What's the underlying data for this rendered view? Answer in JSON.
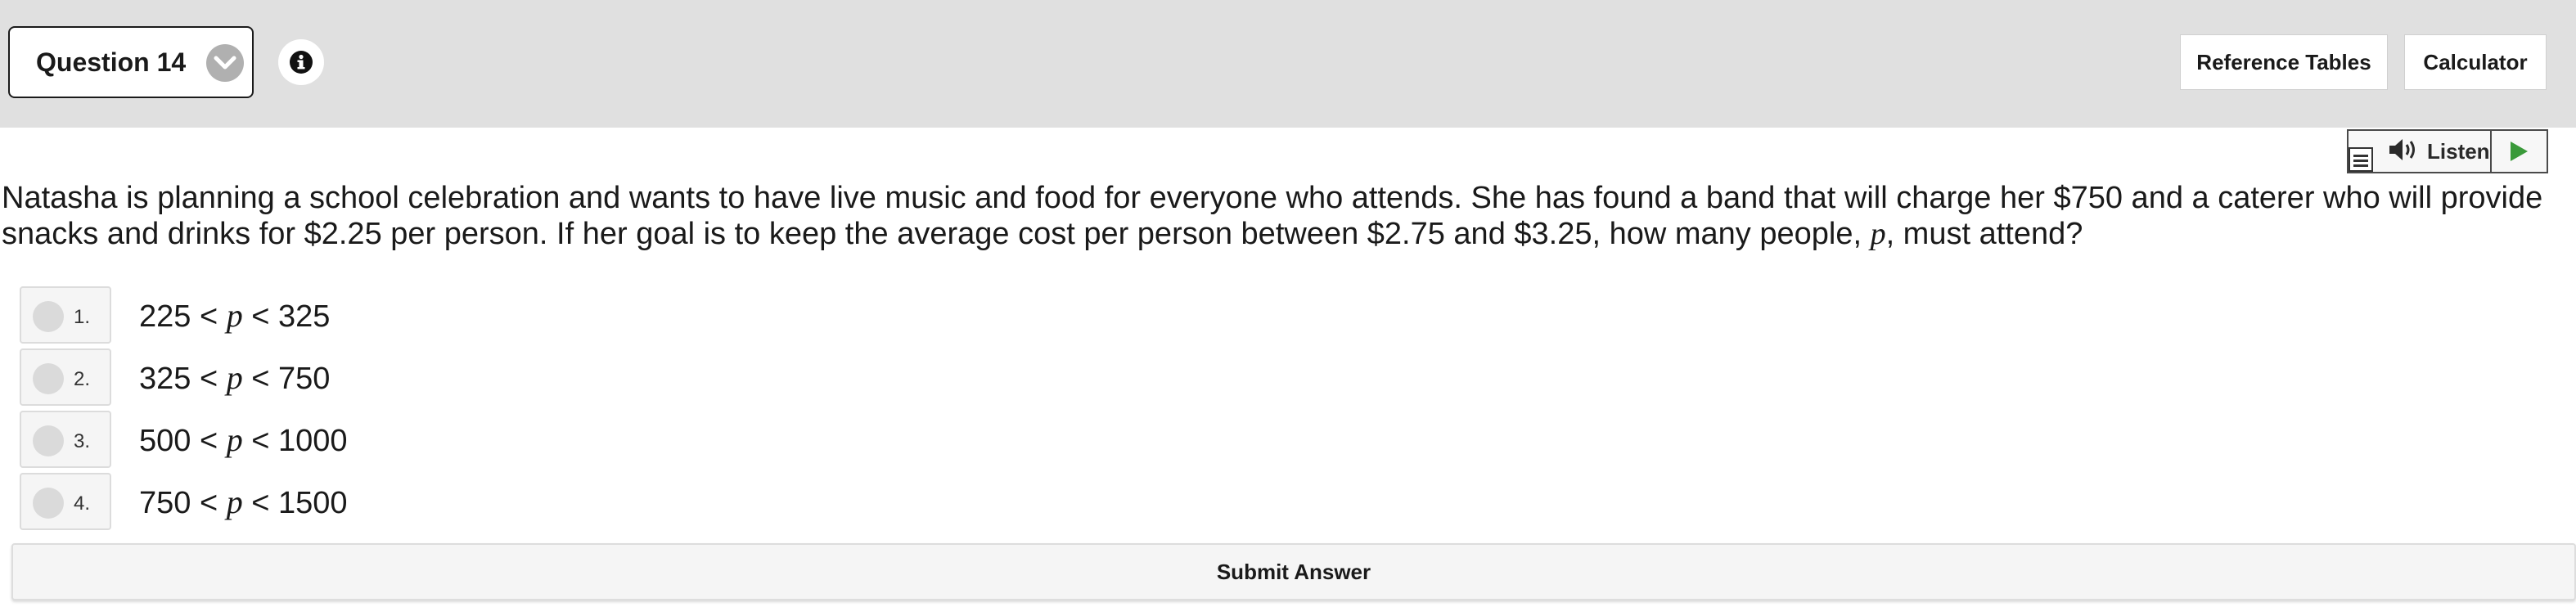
{
  "header": {
    "question_label": "Question 14",
    "reference_tables": "Reference Tables",
    "calculator": "Calculator"
  },
  "listen": {
    "label": "Listen"
  },
  "question": {
    "text_before_var": "Natasha is planning a school celebration and wants to have live music and food for everyone who attends. She has found a band that will charge her $750 and a caterer who will provide snacks and drinks for $2.25 per person. If her goal is to keep the average cost per person between $2.75 and $3.25, how many people, ",
    "variable": "p",
    "text_after_var": ", must attend?"
  },
  "choices": [
    {
      "number": "1.",
      "left": "225 < ",
      "var": "p",
      "right": " < 325"
    },
    {
      "number": "2.",
      "left": "325 < ",
      "var": "p",
      "right": " < 750"
    },
    {
      "number": "3.",
      "left": "500 < ",
      "var": "p",
      "right": " < 1000"
    },
    {
      "number": "4.",
      "left": "750 < ",
      "var": "p",
      "right": " < 1500"
    }
  ],
  "submit_label": "Submit Answer",
  "colors": {
    "header_bg": "#e0e0e0",
    "play_green": "#3a9a3a"
  }
}
